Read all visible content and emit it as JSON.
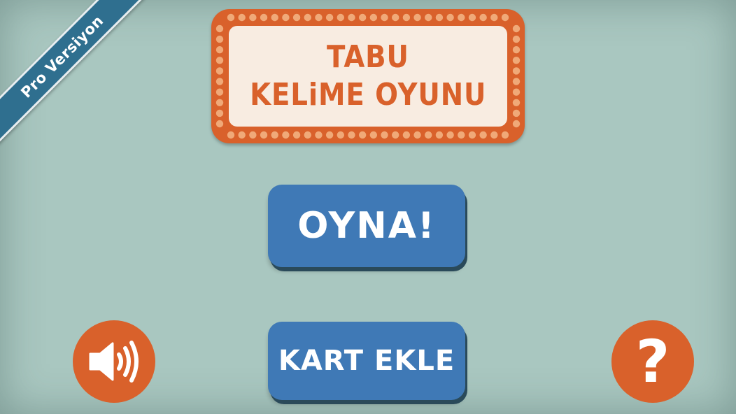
{
  "ribbon": {
    "label": "Pro Versiyon",
    "color": "#2f6f8f"
  },
  "title": {
    "line1": "TABU",
    "line2": "KELiME OYUNU",
    "board_color": "#d9612b",
    "panel_color": "#f8ece1"
  },
  "buttons": {
    "play_label": "OYNA!",
    "add_card_label": "KART EKLE",
    "color": "#3f79b6"
  },
  "icons": {
    "sound": "speaker-volume-icon",
    "help": "question-mark-icon",
    "help_glyph": "?",
    "accent": "#d9612b"
  },
  "background": "#a9c7c0"
}
